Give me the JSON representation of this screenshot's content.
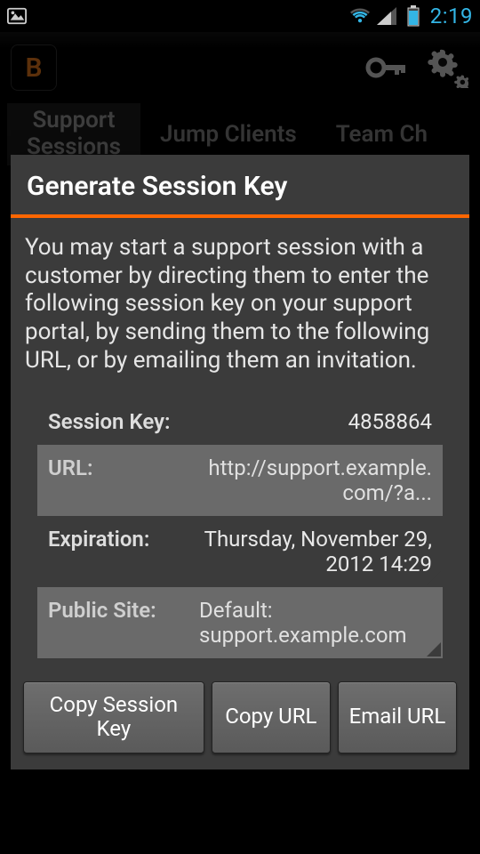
{
  "statusbar": {
    "time": "2:19"
  },
  "app": {
    "icon_letter": "B"
  },
  "tabs": {
    "items": [
      {
        "line1": "Support",
        "line2": "Sessions"
      },
      {
        "label": "Jump Clients"
      },
      {
        "label": "Team Ch"
      }
    ]
  },
  "dialog": {
    "title": "Generate Session Key",
    "body": "You may start a support session with a customer by directing them to enter the following session key on your support portal, by sending them to the following URL, or by emailing them an invitation.",
    "rows": {
      "session_key": {
        "label": "Session Key:",
        "value": "4858864"
      },
      "url": {
        "label": "URL:",
        "value": "http://support.example.com/?a..."
      },
      "expiration": {
        "label": "Expiration:",
        "value": "Thursday, November 29, 2012 14:29"
      },
      "public_site": {
        "label": "Public Site:",
        "value": "Default: support.example.com"
      }
    },
    "buttons": {
      "copy_key": "Copy Session Key",
      "copy_url": "Copy URL",
      "email_url": "Email URL"
    }
  }
}
